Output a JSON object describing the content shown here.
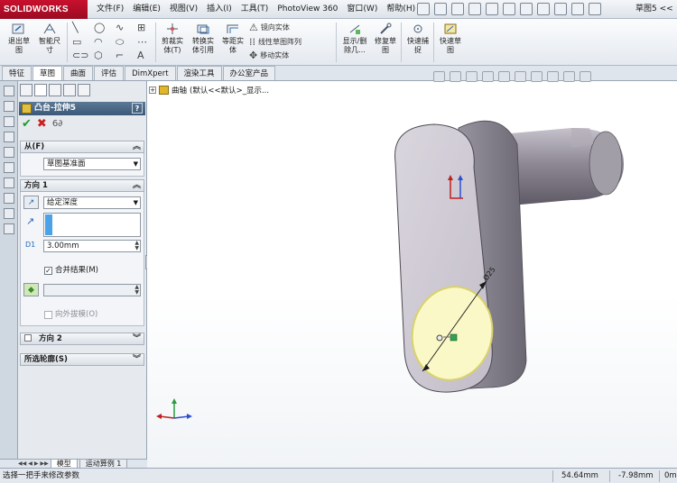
{
  "app": {
    "logo_text": "SOLIDWORKS",
    "document_title": "草图5 <<"
  },
  "menu": [
    "文件(F)",
    "编辑(E)",
    "视图(V)",
    "插入(I)",
    "工具(T)",
    "PhotoView 360",
    "窗口(W)",
    "帮助(H)"
  ],
  "commands": {
    "exit_sketch": "退出草\n图",
    "smart_dim": "智能尺\n寸",
    "trim": "剪裁实\n体(T)",
    "convert": "转换实\n体引用",
    "offset": "等距实\n体",
    "mirror": "镜向实体",
    "linear_pattern": "线性草图阵列",
    "move": "移动实体",
    "display_delete": "显示/删\n除几...",
    "repair": "修复草\n图",
    "quick_snap": "快速捕\n捉",
    "rapid_sketch": "快速草\n图"
  },
  "tabs": [
    "特征",
    "草图",
    "曲面",
    "评估",
    "DimXpert",
    "渲染工具",
    "办公室产品"
  ],
  "active_tab": "草图",
  "feature_tree": {
    "item_label": "曲轴",
    "item_config": "(默认<<默认>_显示..."
  },
  "property_manager": {
    "title": "凸台-拉伸5",
    "help": "?",
    "from": {
      "header": "从(F)",
      "value": "草图基准面"
    },
    "direction1": {
      "header": "方向 1",
      "end_condition": "给定深度",
      "depth": "3.00mm",
      "merge_label": "合并结果(M)",
      "merge_checked": true,
      "draft_outward": "向外拔模(O)"
    },
    "direction2": {
      "header": "方向 2"
    },
    "selected_contours": {
      "header": "所选轮廓(S)"
    }
  },
  "sketch": {
    "dimension": "Ø25"
  },
  "bottom_tabs": [
    "模型",
    "运动算例 1"
  ],
  "status": {
    "message": "选择一把手来修改参数",
    "x": "54.64mm",
    "y": "-7.98mm",
    "z": "0m"
  },
  "colors": {
    "brand": "#c8102e",
    "header": "#3b5878",
    "model": "#c9c3d0",
    "sketch_face": "#fbf8c8"
  }
}
